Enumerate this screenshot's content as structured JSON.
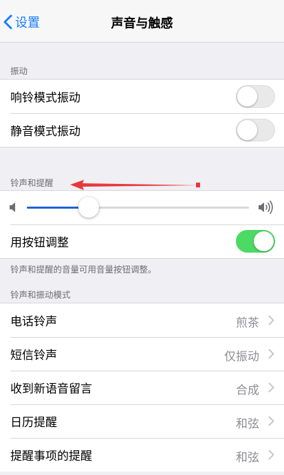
{
  "nav": {
    "back_label": "设置",
    "title": "声音与触感"
  },
  "vibration": {
    "header": "振动",
    "items": [
      {
        "label": "响铃模式振动",
        "on": false
      },
      {
        "label": "静音模式振动",
        "on": false
      }
    ]
  },
  "ringer": {
    "header": "铃声和提醒",
    "volume_fraction": 0.28,
    "buttons_label": "用按钮调整",
    "buttons_on": true,
    "footnote": "铃声和提醒的音量可用音量按钮调整。"
  },
  "patterns": {
    "header": "铃声和振动模式",
    "items": [
      {
        "label": "电话铃声",
        "value": "煎茶"
      },
      {
        "label": "短信铃声",
        "value": "仅振动"
      },
      {
        "label": "收到新语音留言",
        "value": "合成"
      },
      {
        "label": "日历提醒",
        "value": "和弦"
      },
      {
        "label": "提醒事项的提醒",
        "value": "和弦"
      }
    ]
  },
  "colors": {
    "accent": "#157efb",
    "toggle_on": "#4cd964",
    "slider_fill": "#1e62d7",
    "annotation_arrow": "#e8383d"
  },
  "icons": {
    "back": "chevron-left-icon",
    "volume_low": "speaker-low-icon",
    "volume_high": "speaker-high-icon",
    "disclosure": "chevron-right-icon"
  }
}
